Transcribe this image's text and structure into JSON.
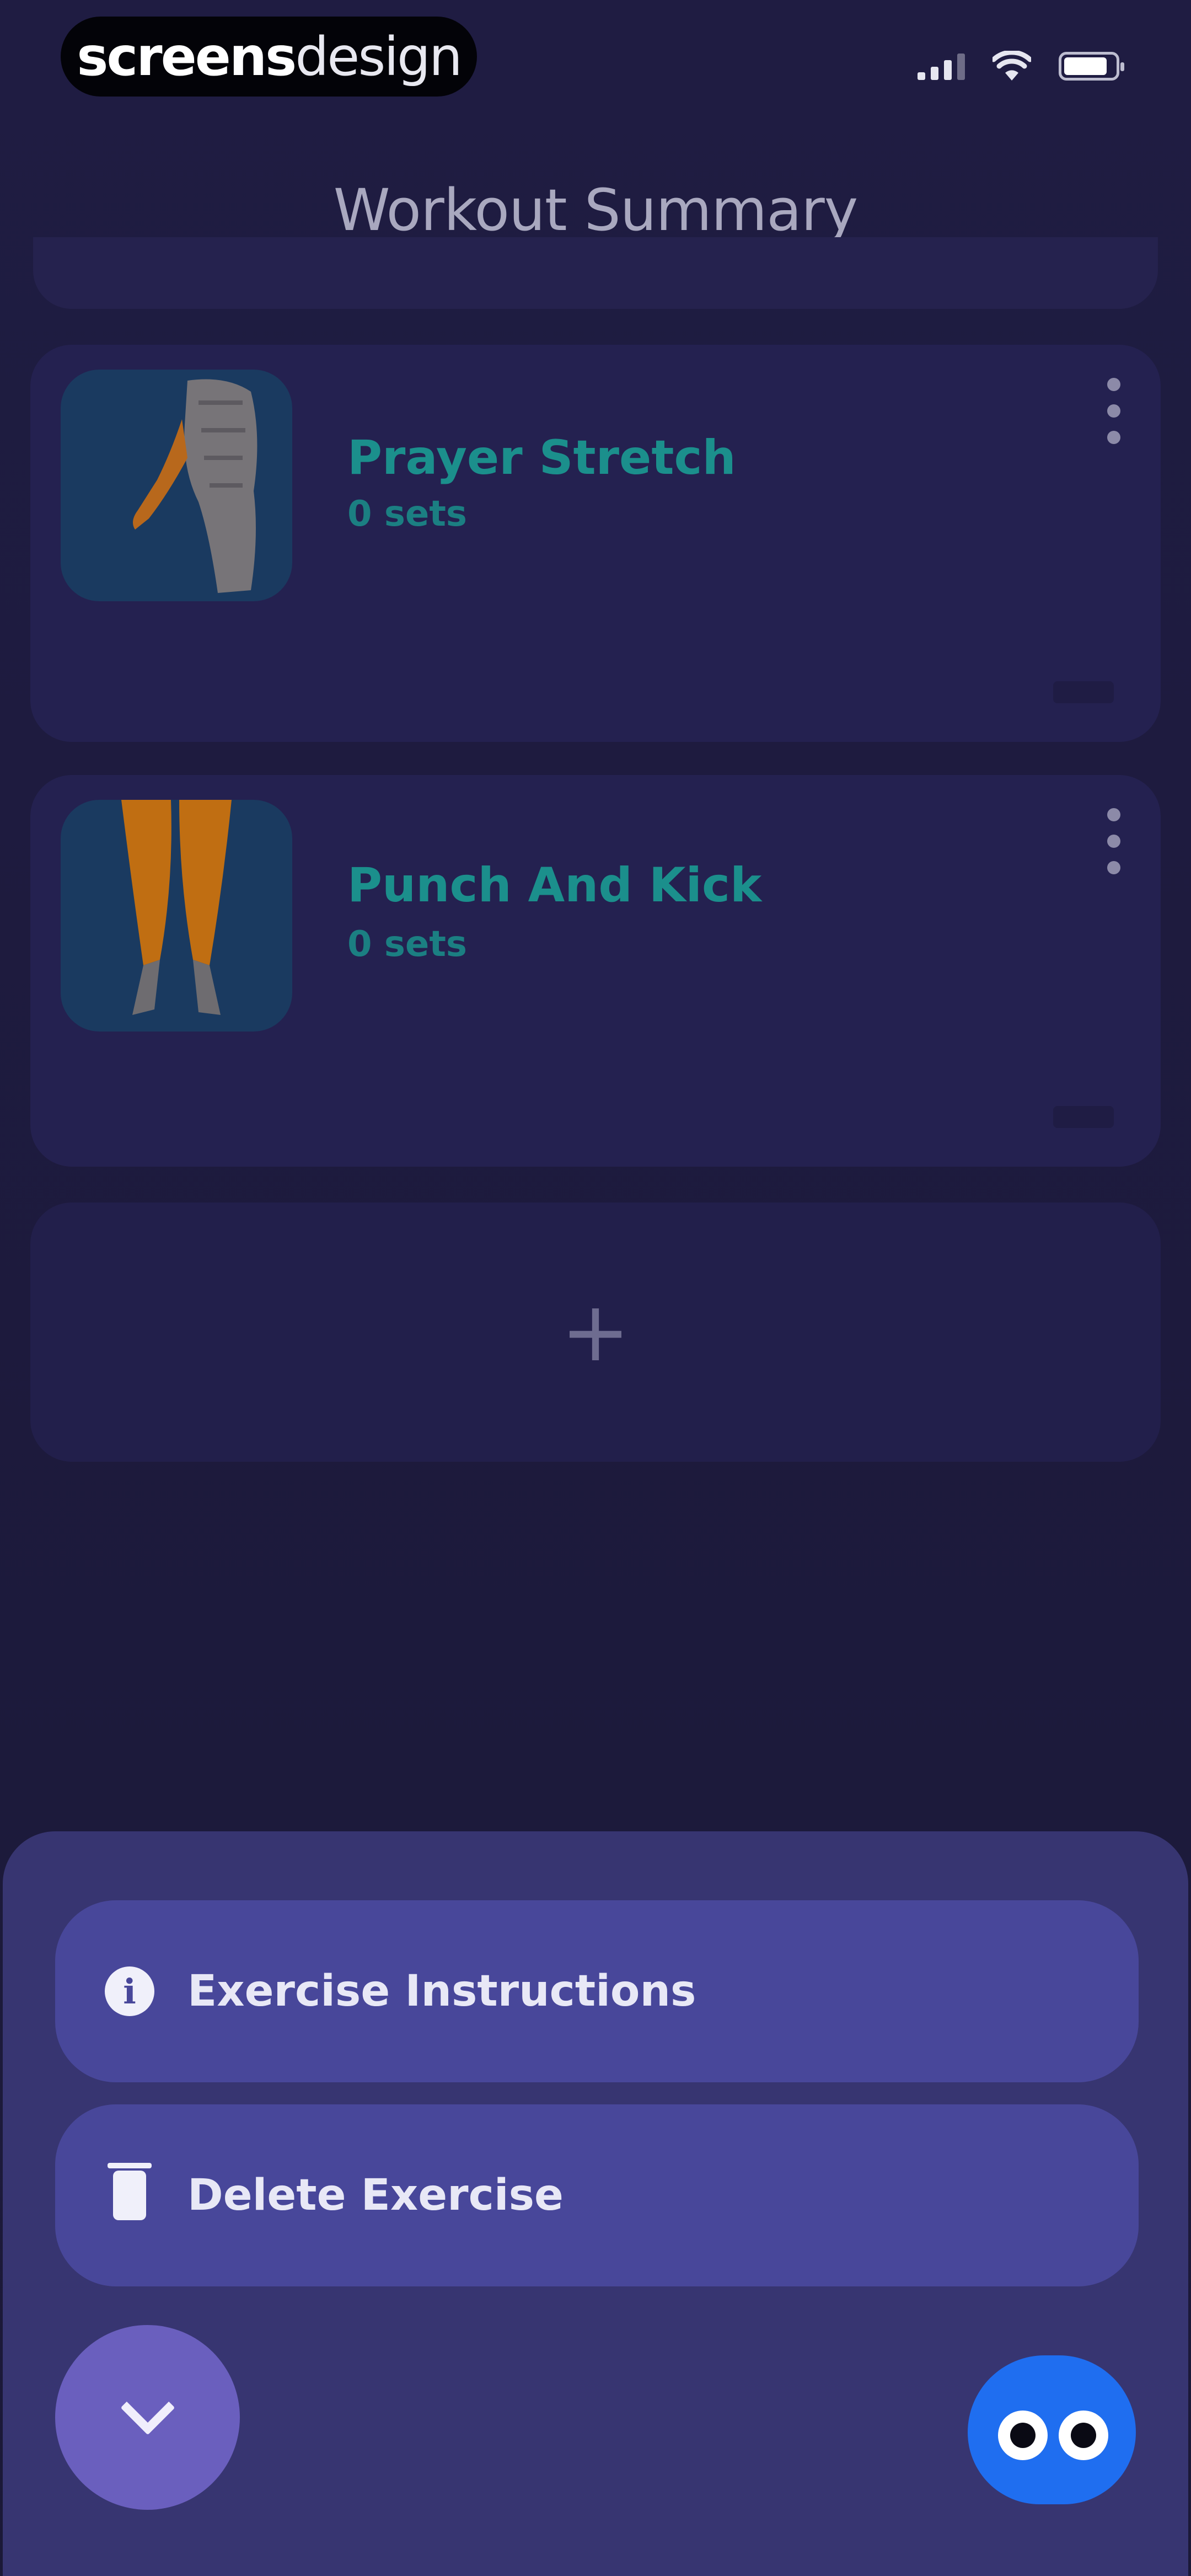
{
  "brand": {
    "bold": "screens",
    "light": "design"
  },
  "header": {
    "title": "Workout Summary"
  },
  "exercises": [
    {
      "name": "Prayer Stretch",
      "sets": "0 sets"
    },
    {
      "name": "Punch And Kick",
      "sets": "0 sets"
    }
  ],
  "add_card": {
    "symbol": "+"
  },
  "sheet": {
    "actions": [
      {
        "label": "Exercise Instructions",
        "icon": "info-icon"
      },
      {
        "label": "Delete Exercise",
        "icon": "trash-icon"
      }
    ],
    "collapse_icon": "chevron-down-icon",
    "assistant_icon": "mascot-eyes-icon"
  },
  "colors": {
    "background": "#1e1b40",
    "card": "#242150",
    "accent_text": "#1b8f8c",
    "sheet": "#373571",
    "sheet_button": "#48479a",
    "collapse_button": "#6a5fbe",
    "mascot": "#1f6ef0"
  }
}
